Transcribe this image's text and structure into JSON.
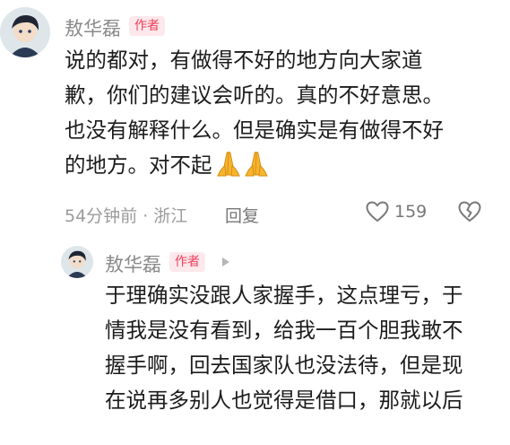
{
  "comment": {
    "author": "敖华磊",
    "badge": "作者",
    "lines": [
      "说的都对，有做得不好的地方向大家道",
      "歉，你们的建议会听的。真的不好意思。",
      "也没有解释什么。但是确实是有做得不好",
      "的地方。对不起"
    ],
    "emoji": "pray-hands-icon",
    "meta": "54分钟前 · 浙江",
    "reply_label": "回复",
    "likes": "159"
  },
  "reply": {
    "author": "敖华磊",
    "badge": "作者",
    "lines": [
      "于理确实没跟人家握手，这点理亏，于",
      "情我是没有看到，给我一百个胆我敢不",
      "握手啊，回去国家队也没法待，但是现",
      "在说再多别人也觉得是借口，那就以后"
    ]
  },
  "colors": {
    "badge_bg": "#fde9ec",
    "badge_text": "#f0405a",
    "meta_text": "#9b9b9b"
  }
}
